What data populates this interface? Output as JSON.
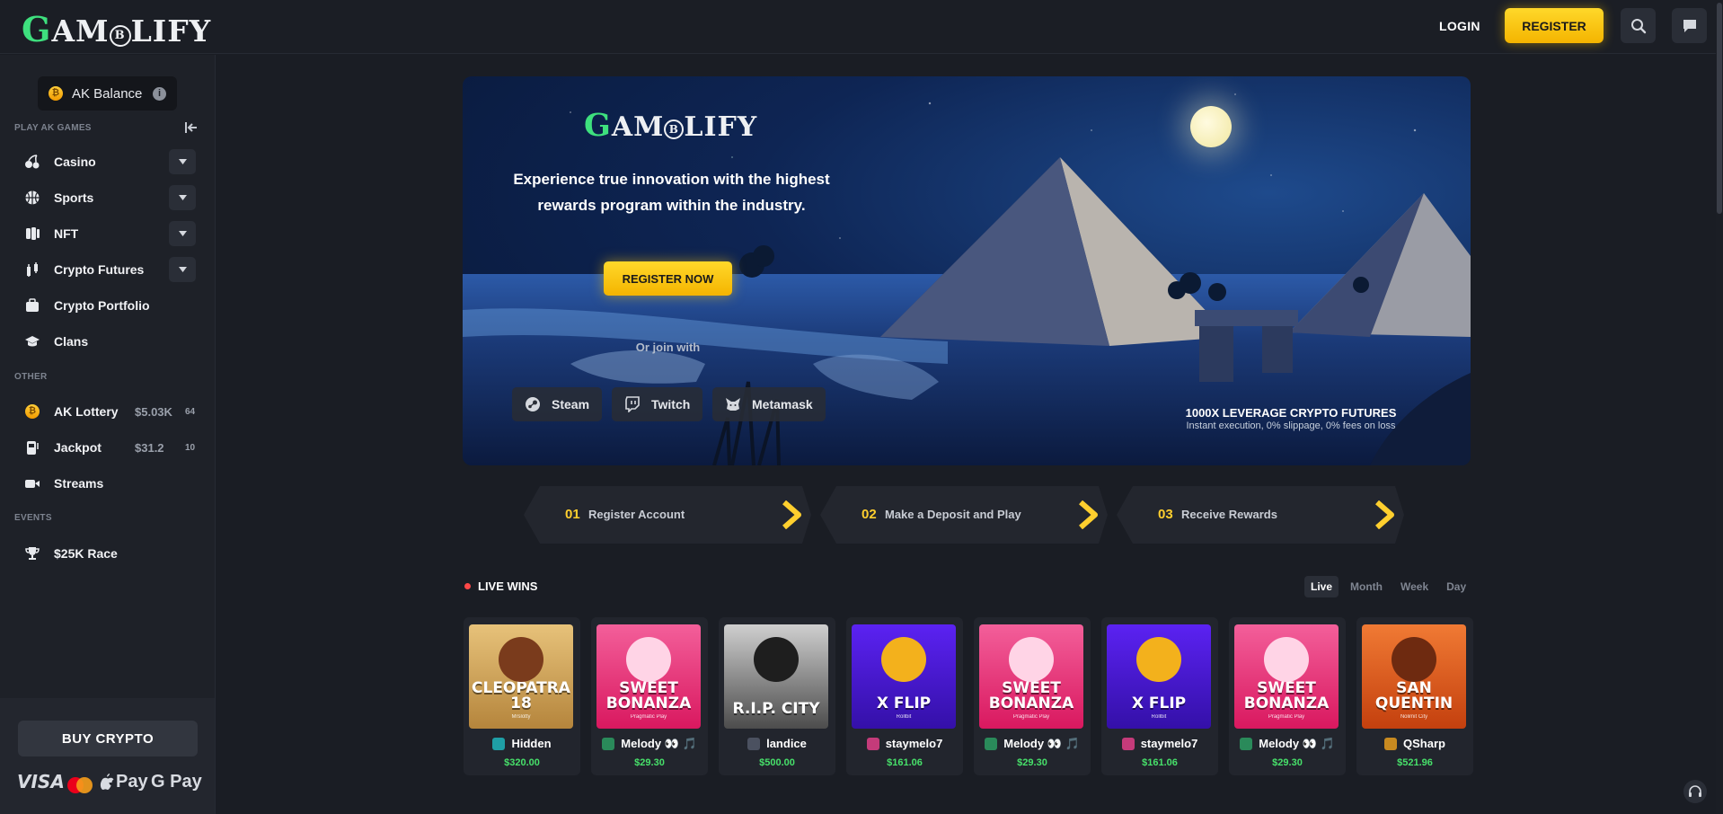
{
  "header": {
    "logo": {
      "g": "G",
      "rest_a": "AM",
      "o": "B",
      "rest_b": "LIFY"
    },
    "login_label": "LOGIN",
    "register_label": "REGISTER"
  },
  "sidebar": {
    "balance": {
      "coin": "₿",
      "label": "AK Balance",
      "info": "i"
    },
    "play_label": "PLAY AK GAMES",
    "items": [
      {
        "label": "Casino",
        "icon": "cherries-icon",
        "dropdown": true
      },
      {
        "label": "Sports",
        "icon": "basketball-icon",
        "dropdown": true
      },
      {
        "label": "NFT",
        "icon": "nft-icon",
        "dropdown": true
      },
      {
        "label": "Crypto Futures",
        "icon": "candlestick-icon",
        "dropdown": true
      },
      {
        "label": "Crypto Portfolio",
        "icon": "briefcase-icon",
        "dropdown": false
      },
      {
        "label": "Clans",
        "icon": "mortarboard-icon",
        "dropdown": false
      }
    ],
    "other_label": "OTHER",
    "other_items": [
      {
        "label": "AK Lottery",
        "amount": "$5.03K",
        "count": "64",
        "icon": "coin-icon"
      },
      {
        "label": "Jackpot",
        "amount": "$31.2",
        "count": "10",
        "icon": "jackpot-icon"
      },
      {
        "label": "Streams",
        "icon": "video-icon"
      }
    ],
    "events_label": "EVENTS",
    "event_items": [
      {
        "label": "$25K Race",
        "icon": "trophy-icon"
      }
    ],
    "buy_crypto_label": "BUY CRYPTO",
    "payments": {
      "visa": "VISA",
      "apple": "Pay",
      "google": "G Pay"
    }
  },
  "hero": {
    "logo": {
      "g": "G",
      "rest_a": "AM",
      "o": "B",
      "rest_b": "LIFY"
    },
    "tagline": "Experience true innovation with the highest rewards program within the industry.",
    "cta_label": "REGISTER NOW",
    "or_join": "Or join with",
    "socials": [
      {
        "label": "Steam"
      },
      {
        "label": "Twitch"
      },
      {
        "label": "Metamask"
      }
    ],
    "promo_title": "1000X LEVERAGE CRYPTO FUTURES",
    "promo_sub": "Instant execution, 0% slippage, 0% fees on loss"
  },
  "steps": [
    {
      "num": "01",
      "label": "Register Account"
    },
    {
      "num": "02",
      "label": "Make a Deposit and Play"
    },
    {
      "num": "03",
      "label": "Receive Rewards"
    }
  ],
  "live_wins": {
    "title": "LIVE WINS",
    "filters": [
      "Live",
      "Month",
      "Week",
      "Day"
    ],
    "active_filter": "Live",
    "wins": [
      {
        "game": "CLEOPATRA 18",
        "provider": "Mrslotty",
        "user": "Hidden",
        "amount": "$320.00",
        "theme": "cleo"
      },
      {
        "game": "SWEET BONANZA",
        "provider": "Pragmatic Play",
        "user": "Melody 👀 🎵",
        "amount": "$29.30",
        "theme": "sweet"
      },
      {
        "game": "R.I.P. CITY",
        "provider": "",
        "user": "landice",
        "amount": "$500.00",
        "theme": "rip"
      },
      {
        "game": "X FLIP",
        "provider": "Rollbit",
        "user": "staymelo7",
        "amount": "$161.06",
        "theme": "xflip"
      },
      {
        "game": "SWEET BONANZA",
        "provider": "Pragmatic Play",
        "user": "Melody 👀 🎵",
        "amount": "$29.30",
        "theme": "sweet"
      },
      {
        "game": "X FLIP",
        "provider": "Rollbit",
        "user": "staymelo7",
        "amount": "$161.06",
        "theme": "xflip"
      },
      {
        "game": "SWEET BONANZA",
        "provider": "Pragmatic Play",
        "user": "Melody 👀 🎵",
        "amount": "$29.30",
        "theme": "sweet"
      },
      {
        "game": "SAN QUENTIN",
        "provider": "Nolimit City",
        "user": "QSharp",
        "amount": "$521.96",
        "theme": "san"
      }
    ]
  },
  "colors": {
    "accent": "#ffd000",
    "brand_green": "#3ee07e",
    "win_green": "#47e06a",
    "bg": "#1a1d24",
    "live_dot": "#ff4848"
  }
}
